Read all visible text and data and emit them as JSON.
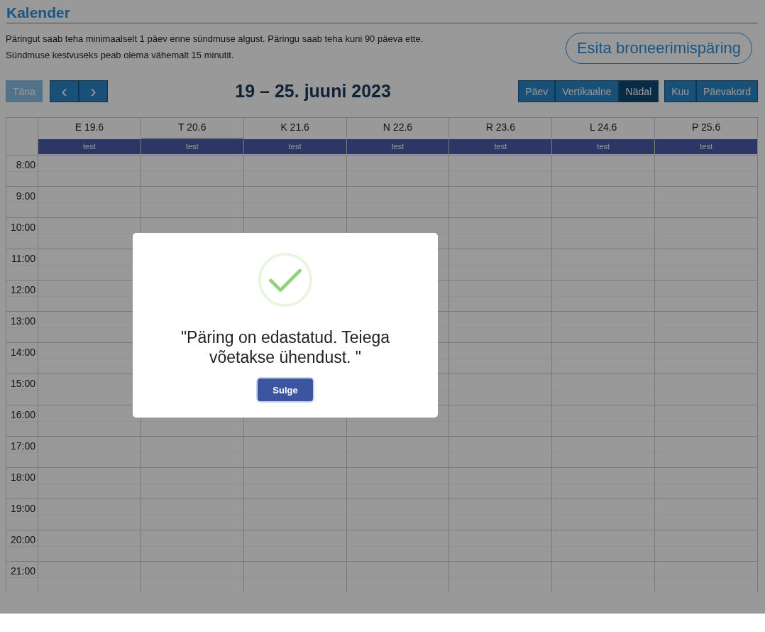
{
  "page": {
    "title": "Kalender",
    "notes": [
      "Päringut saab teha minimaalselt 1 päev enne sündmuse algust. Päringu saab teha kuni 90 päeva ette.",
      "Sündmuse kestvuseks peab olema vähemalt 15 minutit."
    ],
    "request_button": "Esita broneerimispäring"
  },
  "toolbar": {
    "today_button": {
      "label": "Täna",
      "disabled": true
    },
    "prev": "‹",
    "next": "›",
    "range_title": "19 – 25. juuni 2023",
    "view_groups": [
      [
        {
          "label": "Päev",
          "selected": false
        },
        {
          "label": "Vertikaalne",
          "selected": false
        },
        {
          "label": "Nädal",
          "selected": true
        }
      ],
      [
        {
          "label": "Kuu",
          "selected": false
        },
        {
          "label": "Päevakord",
          "selected": false
        }
      ]
    ]
  },
  "days": [
    {
      "label": "E 19.6",
      "event": "test",
      "today": false
    },
    {
      "label": "T 20.6",
      "event": "test",
      "today": true
    },
    {
      "label": "K 21.6",
      "event": "test",
      "today": false
    },
    {
      "label": "N 22.6",
      "event": "test",
      "today": false
    },
    {
      "label": "R 23.6",
      "event": "test",
      "today": false
    },
    {
      "label": "L 24.6",
      "event": "test",
      "today": false
    },
    {
      "label": "P 25.6",
      "event": "test",
      "today": false
    }
  ],
  "hours": [
    "8:00",
    "9:00",
    "10:00",
    "11:00",
    "12:00",
    "13:00",
    "14:00",
    "15:00",
    "16:00",
    "17:00",
    "18:00",
    "19:00",
    "20:00",
    "21:00"
  ],
  "dialog": {
    "message": "\"Päring on edastatud. Teiega võetakse ühendust. \"",
    "close_button": "Sulge"
  }
}
